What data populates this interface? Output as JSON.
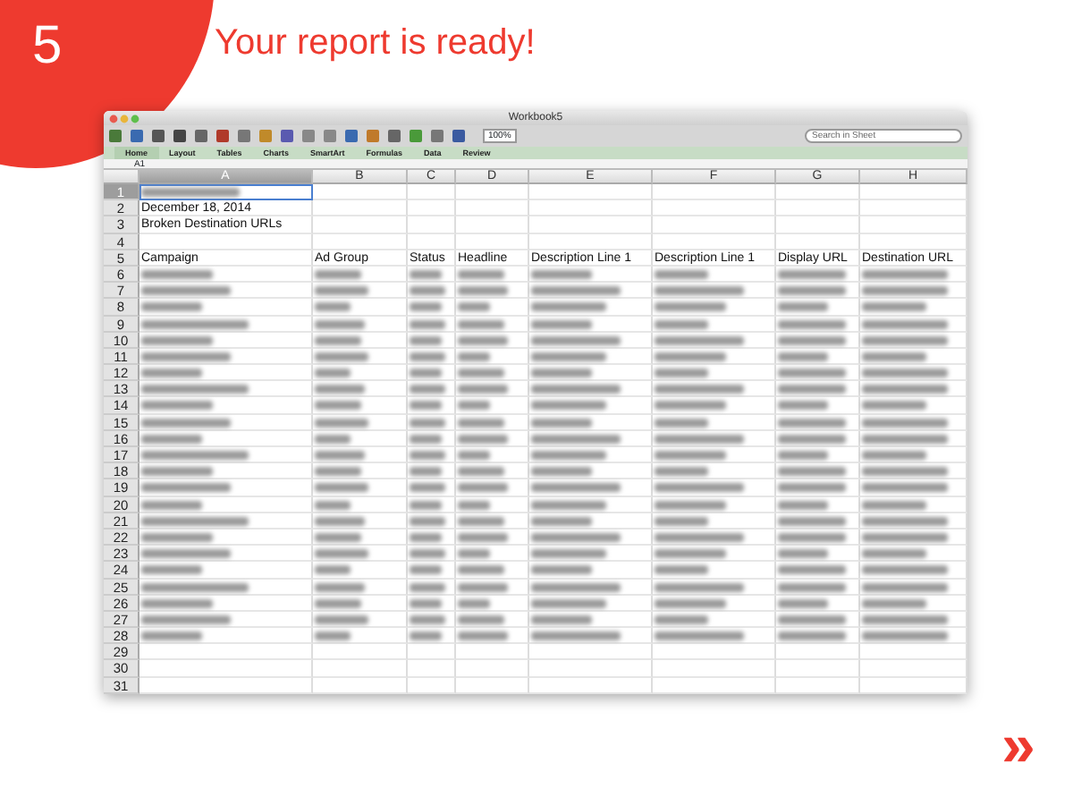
{
  "step": {
    "number": "5",
    "title": "Your report is ready!"
  },
  "window": {
    "title": "Workbook5",
    "zoom": "100%",
    "search": {
      "placeholder": "Search in Sheet"
    },
    "ribbon_tabs": [
      {
        "label": "Home",
        "selected": true
      },
      {
        "label": "Layout",
        "selected": false
      },
      {
        "label": "Tables",
        "selected": false
      },
      {
        "label": "Charts",
        "selected": false
      },
      {
        "label": "SmartArt",
        "selected": false
      },
      {
        "label": "Formulas",
        "selected": false
      },
      {
        "label": "Data",
        "selected": false
      },
      {
        "label": "Review",
        "selected": false
      }
    ],
    "name_box": "A1",
    "columns": [
      {
        "label": "A",
        "selected": true
      },
      {
        "label": "B",
        "selected": false
      },
      {
        "label": "C",
        "selected": false
      },
      {
        "label": "D",
        "selected": false
      },
      {
        "label": "E",
        "selected": false
      },
      {
        "label": "F",
        "selected": false
      },
      {
        "label": "G",
        "selected": false
      },
      {
        "label": "H",
        "selected": false
      }
    ],
    "rows": [
      {
        "number": "1",
        "selected": true,
        "kind": "cells",
        "cells": [
          {
            "kind": "blurred",
            "selected": true
          }
        ]
      },
      {
        "number": "2",
        "selected": false,
        "kind": "cells",
        "cells": [
          {
            "kind": "text",
            "text": "December 18, 2014",
            "selected": false
          }
        ]
      },
      {
        "number": "3",
        "selected": false,
        "kind": "cells",
        "cells": [
          {
            "kind": "text",
            "text": "Broken Destination URLs",
            "selected": false
          }
        ]
      },
      {
        "number": "4",
        "selected": false,
        "kind": "empty"
      },
      {
        "number": "5",
        "selected": false,
        "kind": "cells",
        "cells": [
          {
            "kind": "text",
            "text": "Campaign",
            "selected": false
          },
          {
            "kind": "text",
            "text": "Ad Group",
            "selected": false
          },
          {
            "kind": "text",
            "text": "Status",
            "selected": false
          },
          {
            "kind": "text",
            "text": "Headline",
            "selected": false
          },
          {
            "kind": "text",
            "text": "Description Line 1",
            "selected": false
          },
          {
            "kind": "text",
            "text": "Description Line 1",
            "selected": false
          },
          {
            "kind": "text",
            "text": "Display URL",
            "selected": false
          },
          {
            "kind": "text",
            "text": "Destination URL",
            "selected": false
          }
        ]
      },
      {
        "number": "6",
        "selected": false,
        "kind": "blurred"
      },
      {
        "number": "7",
        "selected": false,
        "kind": "blurred"
      },
      {
        "number": "8",
        "selected": false,
        "kind": "blurred"
      },
      {
        "number": "9",
        "selected": false,
        "kind": "blurred"
      },
      {
        "number": "10",
        "selected": false,
        "kind": "blurred"
      },
      {
        "number": "11",
        "selected": false,
        "kind": "blurred"
      },
      {
        "number": "12",
        "selected": false,
        "kind": "blurred"
      },
      {
        "number": "13",
        "selected": false,
        "kind": "blurred"
      },
      {
        "number": "14",
        "selected": false,
        "kind": "blurred"
      },
      {
        "number": "15",
        "selected": false,
        "kind": "blurred"
      },
      {
        "number": "16",
        "selected": false,
        "kind": "blurred"
      },
      {
        "number": "17",
        "selected": false,
        "kind": "blurred"
      },
      {
        "number": "18",
        "selected": false,
        "kind": "blurred"
      },
      {
        "number": "19",
        "selected": false,
        "kind": "blurred"
      },
      {
        "number": "20",
        "selected": false,
        "kind": "blurred"
      },
      {
        "number": "21",
        "selected": false,
        "kind": "blurred"
      },
      {
        "number": "22",
        "selected": false,
        "kind": "blurred"
      },
      {
        "number": "23",
        "selected": false,
        "kind": "blurred"
      },
      {
        "number": "24",
        "selected": false,
        "kind": "blurred"
      },
      {
        "number": "25",
        "selected": false,
        "kind": "blurred"
      },
      {
        "number": "26",
        "selected": false,
        "kind": "blurred"
      },
      {
        "number": "27",
        "selected": false,
        "kind": "blurred"
      },
      {
        "number": "28",
        "selected": false,
        "kind": "blurred"
      },
      {
        "number": "29",
        "selected": false,
        "kind": "empty"
      },
      {
        "number": "30",
        "selected": false,
        "kind": "empty"
      },
      {
        "number": "31",
        "selected": false,
        "kind": "empty"
      }
    ]
  },
  "next": {
    "label": "»"
  }
}
